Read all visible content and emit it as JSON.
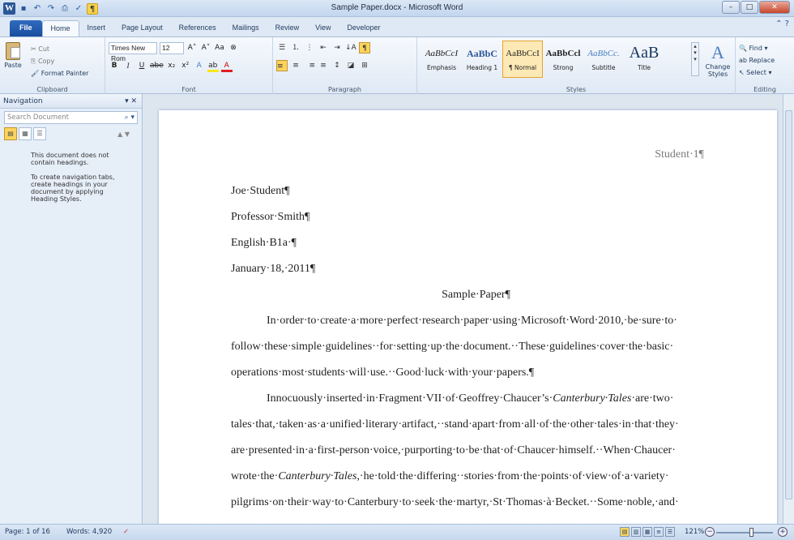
{
  "window": {
    "title": "Sample Paper.docx - Microsoft Word",
    "min": "–",
    "max": "□",
    "close": "✕"
  },
  "qat": {
    "logo": "W",
    "save": "▪",
    "undo": "↶",
    "redo": "↷",
    "print": "⎙",
    "spell": "✓",
    "pilcrow": "¶"
  },
  "tabs": [
    "File",
    "Home",
    "Insert",
    "Page Layout",
    "References",
    "Mailings",
    "Review",
    "View",
    "Developer"
  ],
  "active_tab": "Home",
  "help": "? ",
  "clipboard": {
    "paste": "Paste",
    "cut": "Cut",
    "copy": "Copy",
    "format_painter": "Format Painter",
    "label": "Clipboard"
  },
  "font": {
    "name": "Times New Rom",
    "size": "12",
    "grow": "A˄",
    "shrink": "A˅",
    "case": "Aa",
    "clear": "⊗",
    "bold": "B",
    "italic": "I",
    "underline": "U",
    "strike": "abe",
    "sub": "x₂",
    "sup": "x²",
    "effects": "A",
    "highlight": "ab",
    "color": "A",
    "label": "Font"
  },
  "paragraph": {
    "bullets": "☰",
    "numbering": "⒈",
    "multilevel": "⋮",
    "dec_indent": "⇤",
    "inc_indent": "⇥",
    "sort": "↓A",
    "pilcrow": "¶",
    "align_left": "≡",
    "center": "≡",
    "right": "≡",
    "justify": "≡",
    "line_spacing": "↕",
    "shading": "◪",
    "borders": "⊞",
    "label": "Paragraph"
  },
  "styles": {
    "items": [
      {
        "preview": "AaBbCcI",
        "name": "Emphasis"
      },
      {
        "preview": "AaBbC",
        "name": "Heading 1"
      },
      {
        "preview": "AaBbCcI",
        "name": "¶ Normal"
      },
      {
        "preview": "AaBbCcl",
        "name": "Strong"
      },
      {
        "preview": "AaBbCc.",
        "name": "Subtitle"
      },
      {
        "preview": "AaB",
        "name": "Title"
      }
    ],
    "change": "Change Styles",
    "label": "Styles"
  },
  "editing": {
    "find": "Find",
    "replace": "Replace",
    "select": "Select",
    "label": "Editing"
  },
  "nav": {
    "title": "Navigation",
    "controls": "▾ ✕",
    "search_placeholder": "Search Document",
    "msg1": "This document does not contain headings.",
    "msg2": "To create navigation tabs, create headings in your document by applying Heading Styles."
  },
  "doc": {
    "header": "Student·1¶",
    "lines": [
      "Joe·Student¶",
      "Professor·Smith¶",
      "English·B1a·¶",
      "January·18,·2011¶"
    ],
    "title": "Sample·Paper¶",
    "para": [
      "In·order·to·create·a·more·perfect·research·paper·using·Microsoft·Word·2010,·be·sure·to·",
      "follow·these·simple·guidelines··for·setting·up·the·document.··These·guidelines·cover·the·basic·",
      "operations·most·students·will·use.··Good·luck·with·your·papers.¶",
      "Innocuously·inserted·in·Fragment·VII·of·Geoffrey·Chaucer’s·",
      "Canterbury·Tales",
      "·are·two·",
      "tales·that,·taken·as·a·unified·literary·artifact,··stand·apart·from·all·of·the·other·tales·in·that·they·",
      "are·presented·in·a·first-person·voice,·purporting·to·be·that·of·Chaucer·himself.··When·Chaucer·",
      "wrote·the·",
      "Canterbury·Tales",
      ",·he·told·the·differing··stories·from·the·points·of·view·of·a·variety·",
      "pilgrims·on·their·way·to·Canterbury·to·seek·the·martyr,·St·Thomas·à·Becket.··Some·noble,·and·"
    ]
  },
  "status": {
    "page": "Page: 1 of 16",
    "words": "Words: 4,920",
    "proof": "✓",
    "zoom": "121%",
    "zoom_out": "−",
    "zoom_in": "+"
  }
}
